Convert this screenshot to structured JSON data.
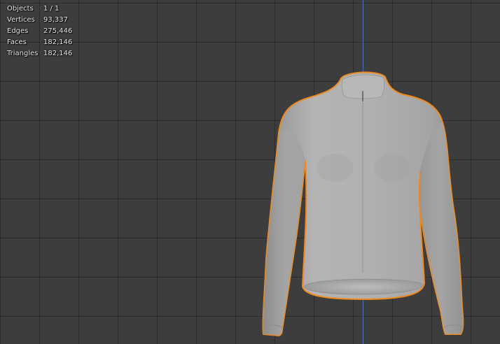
{
  "viewport": {
    "colors": {
      "background": "#3d3d3d",
      "grid_line": "#2e2e2e",
      "axis_z": "#4a78c8",
      "selection_outline": "#f08a1e",
      "mesh": "#a9a9a9"
    },
    "object": {
      "name_icon": "jersey-mesh",
      "selected": true
    }
  },
  "stats": [
    {
      "label": "Objects",
      "value": "1 / 1"
    },
    {
      "label": "Vertices",
      "value": "93,337"
    },
    {
      "label": "Edges",
      "value": "275,446"
    },
    {
      "label": "Faces",
      "value": "182,146"
    },
    {
      "label": "Triangles",
      "value": "182,146"
    }
  ]
}
